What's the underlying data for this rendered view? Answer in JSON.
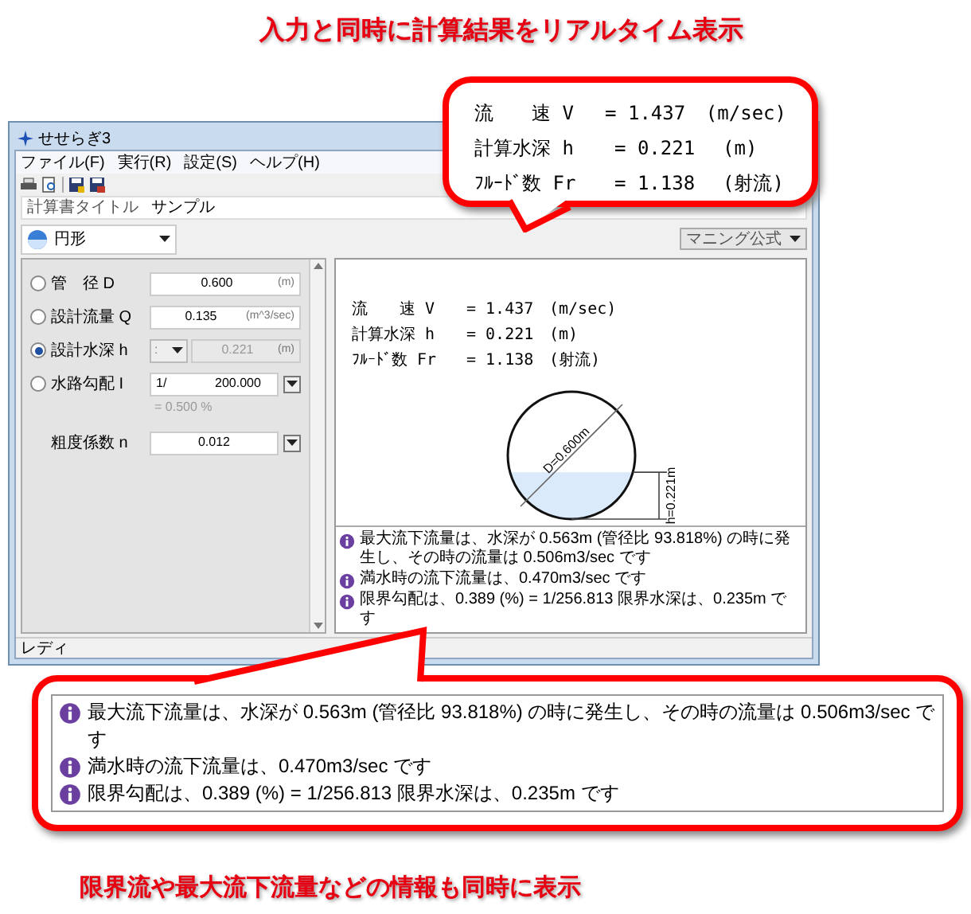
{
  "headline": "入力と同時に計算結果をリアルタイム表示",
  "window": {
    "title": "せせらぎ3",
    "menu": [
      "ファイル(F)",
      "実行(R)",
      "設定(S)",
      "ヘルプ(H)"
    ],
    "status": "レディ"
  },
  "calc_title": {
    "label": "計算書タイトル",
    "value": "サンプル"
  },
  "shape_select": {
    "value": "円形"
  },
  "formula_select": {
    "value": "マニング公式"
  },
  "inputs": [
    {
      "kind": "unit",
      "label": "管　径 D",
      "value": "0.600",
      "unit": "(m)",
      "selected": false,
      "disabled": false
    },
    {
      "kind": "unit",
      "label": "設計流量 Q",
      "value": "0.135",
      "unit": "(m^3/sec)",
      "selected": false,
      "disabled": false
    },
    {
      "kind": "combo",
      "label": "設計水深 h",
      "combo": ":",
      "value": "0.221",
      "unit": "(m)",
      "selected": true,
      "disabled": true
    },
    {
      "kind": "slope",
      "label": "水路勾配 I",
      "prefix": "1/",
      "value": "200.000",
      "note": "= 0.500 %",
      "selected": false,
      "disabled": false
    }
  ],
  "roughness": {
    "label": "粗度係数 n",
    "value": "0.012"
  },
  "results": [
    {
      "name": "流　　速 V",
      "value": "= 1.437",
      "unit": "(m/sec)"
    },
    {
      "name": "計算水深 h",
      "value": "= 0.221",
      "unit": "(m)"
    },
    {
      "name": "ﾌﾙｰﾄﾞ数 Fr",
      "value": "= 1.138",
      "unit": "(射流)"
    }
  ],
  "diagram": {
    "diameter_label": "D=0.600m",
    "depth_label": "h=0.221m",
    "level": 0.368
  },
  "messages": [
    "最大流下流量は、水深が 0.563m (管径比 93.818%) の時に発生し、その時の流量は 0.506m3/sec です",
    "満水時の流下流量は、0.470m3/sec です",
    "限界勾配は、0.389 (%) = 1/256.813 限界水深は、0.235m です"
  ],
  "callout_results": [
    {
      "name": "流　　速 V",
      "value": "= 1.437",
      "unit": "(m/sec)"
    },
    {
      "name": "計算水深 h",
      "value": "= 0.221",
      "unit": "(m)"
    },
    {
      "name": "ﾌﾙｰﾄﾞ数 Fr",
      "value": "= 1.138",
      "unit": "(射流)"
    }
  ],
  "callout_messages": [
    "最大流下流量は、水深が 0.563m (管径比 93.818%) の時に発生し、その時の流量は 0.506m3/sec です",
    "満水時の流下流量は、0.470m3/sec です",
    "限界勾配は、0.389 (%) = 1/256.813 限界水深は、0.235m です"
  ],
  "caption": "限界流や最大流下流量などの情報も同時に表示"
}
